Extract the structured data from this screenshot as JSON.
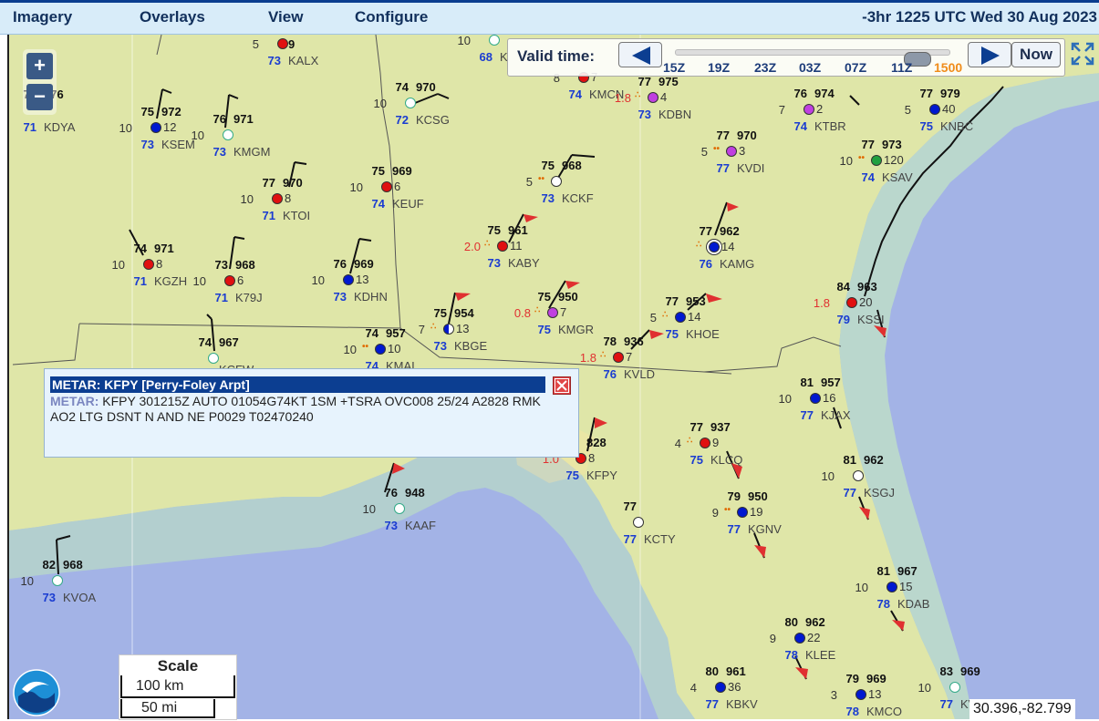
{
  "menu": {
    "imagery": "Imagery",
    "overlays": "Overlays",
    "view": "View",
    "configure": "Configure",
    "time_header": "-3hr 1225 UTC Wed 30 Aug 2023"
  },
  "time_panel": {
    "label": "Valid time:",
    "now": "Now",
    "ticks": [
      "15Z",
      "19Z",
      "23Z",
      "03Z",
      "07Z",
      "11Z",
      "1500"
    ]
  },
  "zoom": {
    "in": "+",
    "out": "−"
  },
  "popup": {
    "title": "METAR: KFPY [Perry-Foley Arpt]",
    "lead": "METAR:",
    "text": "KFPY 301215Z AUTO 01054G74KT 1SM +TSRA OVC008 25/24 A2828 RMK AO2 LTG DSNT N AND NE P0029 T02470240"
  },
  "scale": {
    "title": "Scale",
    "km": "100 km",
    "mi": "50 mi"
  },
  "coords": "30.396,-82.799",
  "colors": {
    "menu_bg": "#d8ecf9",
    "accent": "#0c3e91",
    "land": "#dfe6a8",
    "water": "#a3b3e6",
    "hurricane": "#e03030"
  },
  "stations": [
    {
      "id": "KALX",
      "temp": "",
      "pres": "9",
      "vis": "5",
      "dew": "73",
      "ptd": "",
      "color": "#e01010"
    },
    {
      "id": "KDYA",
      "temp": "73",
      "pres": "976",
      "vis": "",
      "dew": "71",
      "ptd": "",
      "color": "#ffffff"
    },
    {
      "id": "KSEM",
      "temp": "75",
      "pres": "972",
      "vis": "10",
      "dew": "73",
      "ptd": "12",
      "color": "#0018d0"
    },
    {
      "id": "KMGM",
      "temp": "76",
      "pres": "971",
      "vis": "10",
      "dew": "73",
      "ptd": "",
      "color": "#ffffff"
    },
    {
      "id": "KCSG",
      "temp": "74",
      "pres": "970",
      "vis": "10",
      "dew": "72",
      "ptd": "",
      "color": "#ffffff"
    },
    {
      "id": "KMCN",
      "temp": "75",
      "pres": "972",
      "vis": "8",
      "dew": "74",
      "ptd": "7",
      "color": "#e01010"
    },
    {
      "id": "KDBN",
      "temp": "77",
      "pres": "975",
      "vis": "1.8",
      "dew": "73",
      "ptd": "4",
      "color": "#c040e0"
    },
    {
      "id": "KTBR",
      "temp": "76",
      "pres": "974",
      "vis": "7",
      "dew": "74",
      "ptd": "2",
      "color": "#c040e0"
    },
    {
      "id": "KNBC",
      "temp": "77",
      "pres": "979",
      "vis": "5",
      "dew": "75",
      "ptd": "40",
      "color": "#0018d0"
    },
    {
      "id": "KVDI",
      "temp": "77",
      "pres": "970",
      "vis": "5",
      "dew": "77",
      "ptd": "3",
      "color": "#c040e0"
    },
    {
      "id": "KSAV",
      "temp": "77",
      "pres": "973",
      "vis": "10",
      "dew": "74",
      "ptd": "120",
      "color": "#20a040"
    },
    {
      "id": "KCKF",
      "temp": "75",
      "pres": "968",
      "vis": "5",
      "dew": "73",
      "ptd": "",
      "color": "#ffffff"
    },
    {
      "id": "KEUF",
      "temp": "75",
      "pres": "969",
      "vis": "10",
      "dew": "74",
      "ptd": "6",
      "color": "#e01010"
    },
    {
      "id": "KTOI",
      "temp": "77",
      "pres": "970",
      "vis": "10",
      "dew": "71",
      "ptd": "8",
      "color": "#e01010"
    },
    {
      "id": "KABY",
      "temp": "75",
      "pres": "961",
      "vis": "2.0",
      "dew": "73",
      "ptd": "11",
      "color": "#e01010"
    },
    {
      "id": "KAMG",
      "temp": "77",
      "pres": "962",
      "vis": "",
      "dew": "76",
      "ptd": "14",
      "color": "#0018d0"
    },
    {
      "id": "KGZH",
      "temp": "74",
      "pres": "971",
      "vis": "10",
      "dew": "71",
      "ptd": "8",
      "color": "#e01010"
    },
    {
      "id": "K79J",
      "temp": "73",
      "pres": "968",
      "vis": "10",
      "dew": "71",
      "ptd": "6",
      "color": "#e01010"
    },
    {
      "id": "KDHN",
      "temp": "76",
      "pres": "969",
      "vis": "10",
      "dew": "73",
      "ptd": "13",
      "color": "#0018d0"
    },
    {
      "id": "KMGR",
      "temp": "75",
      "pres": "950",
      "vis": "0.8",
      "dew": "75",
      "ptd": "7",
      "color": "#c040e0"
    },
    {
      "id": "KHOE",
      "temp": "77",
      "pres": "953",
      "vis": "5",
      "dew": "75",
      "ptd": "14",
      "color": "#0018d0"
    },
    {
      "id": "KSSI",
      "temp": "84",
      "pres": "963",
      "vis": "1.8",
      "dew": "79",
      "ptd": "20",
      "color": "#e01010"
    },
    {
      "id": "KBGE",
      "temp": "75",
      "pres": "954",
      "vis": "7",
      "dew": "73",
      "ptd": "13",
      "color": "#0018d0"
    },
    {
      "id": "KMAI",
      "temp": "74",
      "pres": "957",
      "vis": "10",
      "dew": "74",
      "ptd": "10",
      "color": "#0018d0"
    },
    {
      "id": "KVLD",
      "temp": "78",
      "pres": "936",
      "vis": "1.8",
      "dew": "76",
      "ptd": "7",
      "color": "#e01010"
    },
    {
      "id": "KCFW",
      "temp": "74",
      "pres": "967",
      "vis": "",
      "dew": "",
      "ptd": "",
      "color": "#ffffff"
    },
    {
      "id": "KJAX",
      "temp": "81",
      "pres": "957",
      "vis": "10",
      "dew": "77",
      "ptd": "16",
      "color": "#0018d0"
    },
    {
      "id": "KLCQ",
      "temp": "77",
      "pres": "937",
      "vis": "4",
      "dew": "75",
      "ptd": "9",
      "color": "#e01010"
    },
    {
      "id": "KFPY",
      "temp": "",
      "pres": "828",
      "vis": "1.0",
      "dew": "75",
      "ptd": "8",
      "color": "#e01010"
    },
    {
      "id": "KSGJ",
      "temp": "81",
      "pres": "962",
      "vis": "10",
      "dew": "77",
      "ptd": "",
      "color": "#ffffff"
    },
    {
      "id": "KAAF",
      "temp": "76",
      "pres": "948",
      "vis": "10",
      "dew": "73",
      "ptd": "",
      "color": "#ffffff"
    },
    {
      "id": "KCTY",
      "temp": "77",
      "pres": "",
      "vis": "",
      "dew": "77",
      "ptd": "",
      "color": "#ffffff"
    },
    {
      "id": "KGNV",
      "temp": "79",
      "pres": "950",
      "vis": "9",
      "dew": "77",
      "ptd": "19",
      "color": "#0018d0"
    },
    {
      "id": "KDAB",
      "temp": "81",
      "pres": "967",
      "vis": "10",
      "dew": "78",
      "ptd": "15",
      "color": "#0018d0"
    },
    {
      "id": "KVOA",
      "temp": "82",
      "pres": "968",
      "vis": "10",
      "dew": "73",
      "ptd": "",
      "color": "#ffffff"
    },
    {
      "id": "KLEE",
      "temp": "80",
      "pres": "962",
      "vis": "9",
      "dew": "78",
      "ptd": "22",
      "color": "#0018d0"
    },
    {
      "id": "KBKV",
      "temp": "80",
      "pres": "961",
      "vis": "4",
      "dew": "77",
      "ptd": "36",
      "color": "#0018d0"
    },
    {
      "id": "KMCO",
      "temp": "79",
      "pres": "969",
      "vis": "3",
      "dew": "78",
      "ptd": "13",
      "color": "#0018d0"
    },
    {
      "id": "KVVR",
      "temp": "83",
      "pres": "969",
      "vis": "10",
      "dew": "77",
      "ptd": "",
      "color": "#ffffff"
    },
    {
      "id": "K",
      "temp": "",
      "pres": "",
      "vis": "10",
      "dew": "68",
      "ptd": "",
      "color": "#ffffff"
    }
  ]
}
